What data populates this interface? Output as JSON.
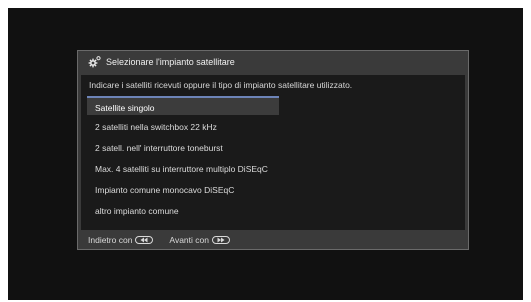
{
  "dialog": {
    "title": "Selezionare l'impianto satellitare",
    "title_icon": "gear-satellite-icon",
    "instruction": "Indicare i satelliti ricevuti oppure il tipo di impianto satellitare utilizzato.",
    "options": [
      "Satellite singolo",
      "2 satelliti nella switchbox 22 kHz",
      "2 satell. nell' interruttore toneburst",
      "Max. 4 satelliti su interruttore multiplo DiSEqC",
      "Impianto comune monocavo DiSEqC",
      "altro impianto comune"
    ],
    "selected_index": 0
  },
  "footer": {
    "back_label": "Indietro con",
    "back_icon": "rewind-button-icon",
    "next_label": "Avanti con",
    "next_icon": "forward-button-icon"
  },
  "colors": {
    "screen_bg": "#111111",
    "dialog_bg": "#3a3a3a",
    "inner_bg": "#1a1a1a",
    "selection_accent": "#6d84b8"
  }
}
